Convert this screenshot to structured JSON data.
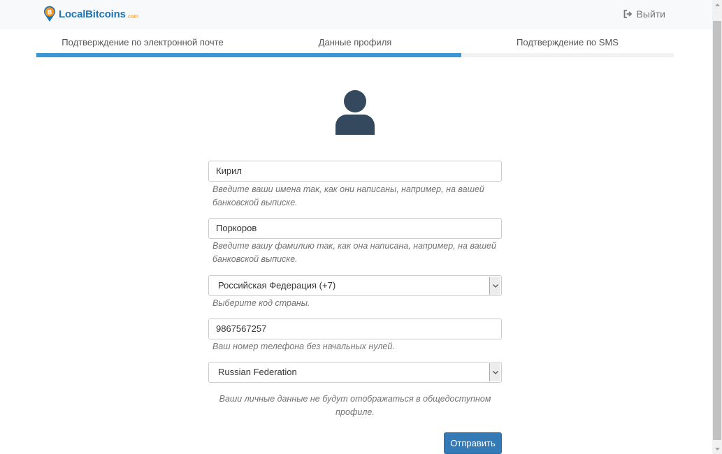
{
  "header": {
    "logo_text": "LocalBitcoins",
    "logo_suffix": ".com",
    "logout_label": "Выйти",
    "logout_icon": "sign-out-icon"
  },
  "steps": {
    "items": [
      {
        "label": "Подтверждение по электронной почте"
      },
      {
        "label": "Данные профиля"
      },
      {
        "label": "Подтверждение по SMS"
      }
    ],
    "progress_fraction": 0.667
  },
  "form": {
    "avatar_icon": "user-icon",
    "first_name": {
      "value": "Кирил",
      "help": "Введите ваши имена так, как они написаны, например, на вашей банковской выписке."
    },
    "last_name": {
      "value": "Поркоров",
      "help": "Введите вашу фамилию так, как она написана, например, на вашей банковской выписке."
    },
    "country_code": {
      "selected": "Российская Федерация (+7)",
      "help": "Выберите код страны."
    },
    "phone": {
      "value": "9867567257",
      "help": "Ваш номер телефона без начальных нулей."
    },
    "country": {
      "selected": "Russian Federation"
    },
    "privacy_note": "Ваши личные данные не будут отображаться в общедоступном профиле.",
    "submit_label": "Отправить"
  },
  "colors": {
    "brand_blue": "#1d76b8",
    "progress_blue": "#3a97d4",
    "button_blue": "#337ab7",
    "avatar": "#34495e",
    "bitcoin_orange": "#f7931a"
  }
}
